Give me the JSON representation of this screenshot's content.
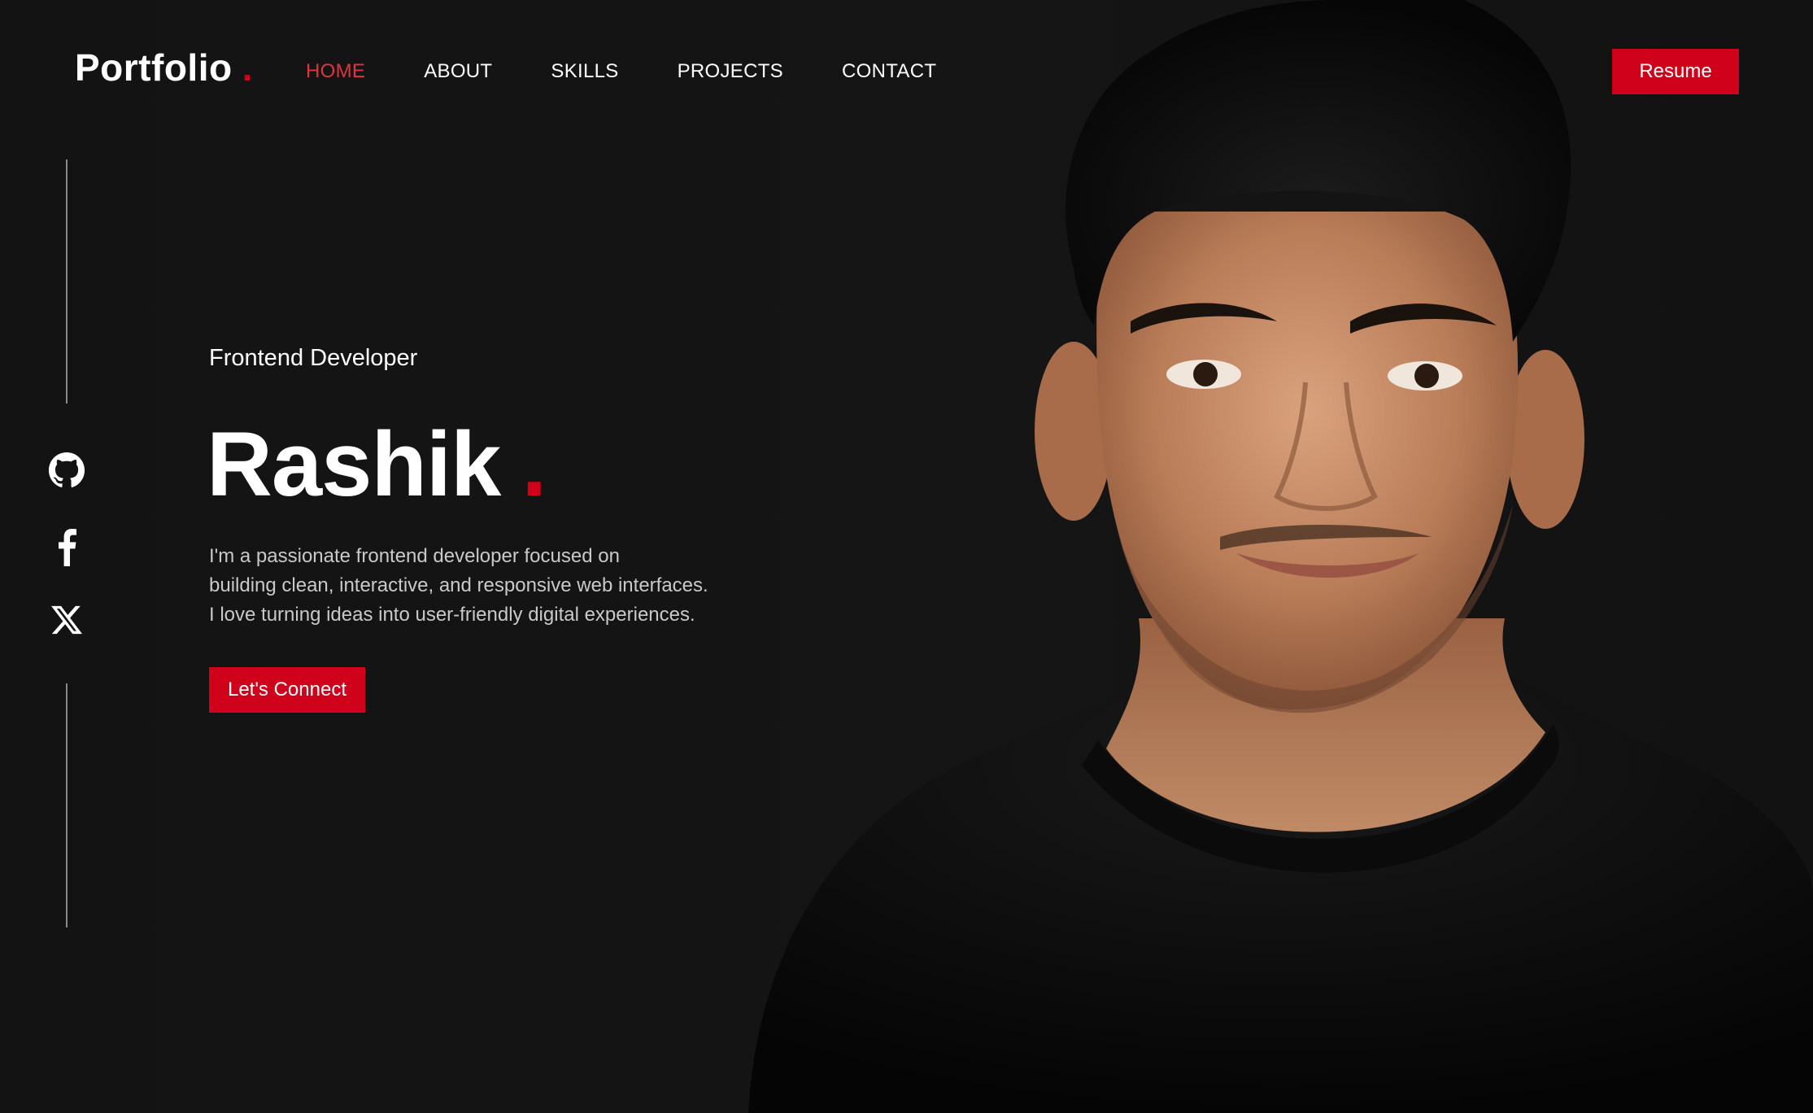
{
  "brand": {
    "name": "Portfolio",
    "dot": "."
  },
  "nav": {
    "items": [
      {
        "label": "HOME",
        "active": true
      },
      {
        "label": "ABOUT",
        "active": false
      },
      {
        "label": "SKILLS",
        "active": false
      },
      {
        "label": "PROJECTS",
        "active": false
      },
      {
        "label": "CONTACT",
        "active": false
      }
    ]
  },
  "header": {
    "resume_label": "Resume"
  },
  "social": {
    "icons": [
      "github-icon",
      "facebook-icon",
      "x-icon"
    ]
  },
  "hero": {
    "role": "Frontend Developer",
    "name": "Rashik",
    "name_dot": ".",
    "bio_lines": [
      "I'm a passionate frontend developer focused on",
      "building clean, interactive, and responsive web interfaces.",
      "I love turning ideas into user-friendly digital experiences."
    ],
    "cta_label": "Let's Connect"
  },
  "colors": {
    "background": "#141414",
    "accent": "#d0021b",
    "active_nav": "#e0343f",
    "text": "#ffffff",
    "muted_text": "#c9c9c9"
  }
}
